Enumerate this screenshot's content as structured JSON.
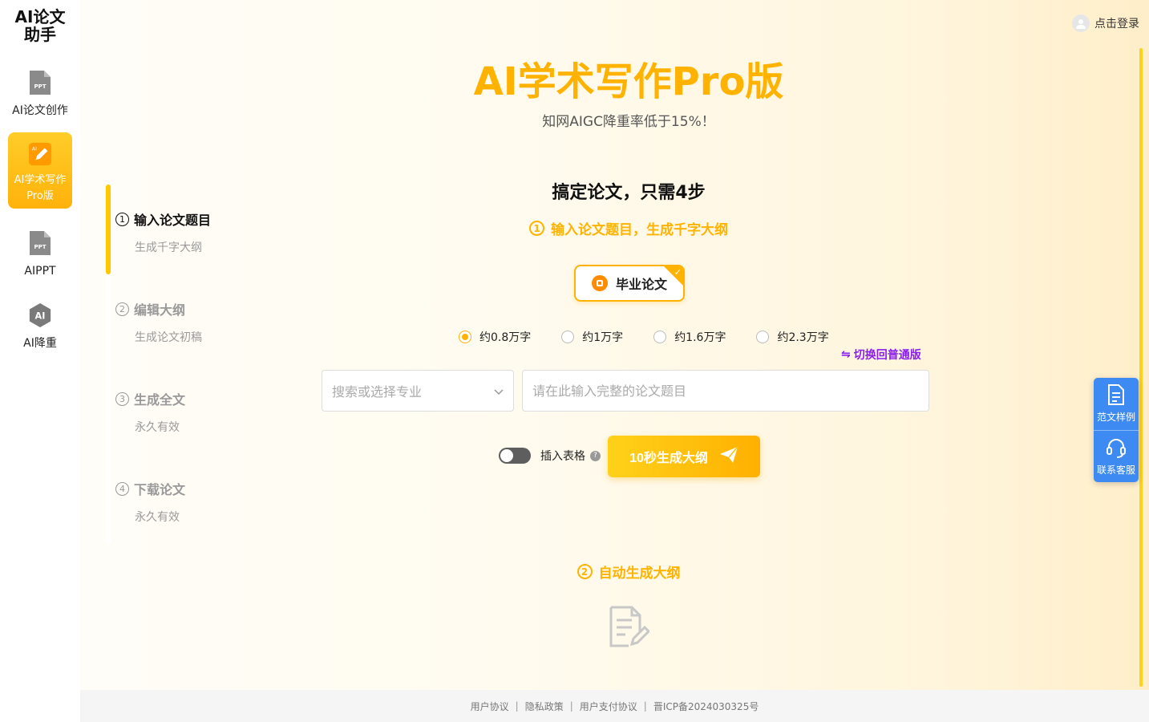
{
  "sidebar": {
    "logo": "AI论文助手",
    "items": [
      {
        "label": "AI论文创作",
        "icon": "ppt-file-icon"
      },
      {
        "label": "AI学术写作Pro版",
        "icon": "ai-pen-icon",
        "active": true
      },
      {
        "label": "AIPPT",
        "icon": "ppt-file-icon"
      },
      {
        "label": "AI降重",
        "icon": "ai-shield-icon"
      }
    ]
  },
  "header": {
    "login_label": "点击登录"
  },
  "hero": {
    "title": "AI学术写作Pro版",
    "subtitle": "知网AIGC降重率低于15%！"
  },
  "steps": [
    {
      "num": "1",
      "title": "输入论文题目",
      "sub": "生成千字大纲",
      "active": true
    },
    {
      "num": "2",
      "title": "编辑大纲",
      "sub": "生成论文初稿"
    },
    {
      "num": "3",
      "title": "生成全文",
      "sub": "永久有效"
    },
    {
      "num": "4",
      "title": "下载论文",
      "sub": "永久有效"
    }
  ],
  "form": {
    "heading": "搞定论文，只需4步",
    "step1_num": "1",
    "step1_label": "输入论文题目，生成千字大纲",
    "paper_type": "毕业论文",
    "word_options": [
      {
        "label": "约0.8万字",
        "checked": true
      },
      {
        "label": "约1万字"
      },
      {
        "label": "约1.6万字"
      },
      {
        "label": "约2.3万字"
      }
    ],
    "switch_label": "切换回普通版",
    "major_placeholder": "搜索或选择专业",
    "title_placeholder": "请在此输入完整的论文题目",
    "table_toggle_label": "插入表格",
    "table_toggle_on": false,
    "generate_label": "10秒生成大纲",
    "step2_num": "2",
    "step2_label": "自动生成大纲"
  },
  "float_panel": [
    {
      "label": "范文样例",
      "icon": "document-icon"
    },
    {
      "label": "联系客服",
      "icon": "headset-icon"
    }
  ],
  "footer": {
    "links": [
      "用户协议",
      "隐私政策",
      "用户支付协议",
      "晋ICP备2024030325号"
    ]
  },
  "colors": {
    "accent": "#ffb300",
    "link_purple": "#8b1cf0",
    "float_blue": "#3d8bf2"
  }
}
